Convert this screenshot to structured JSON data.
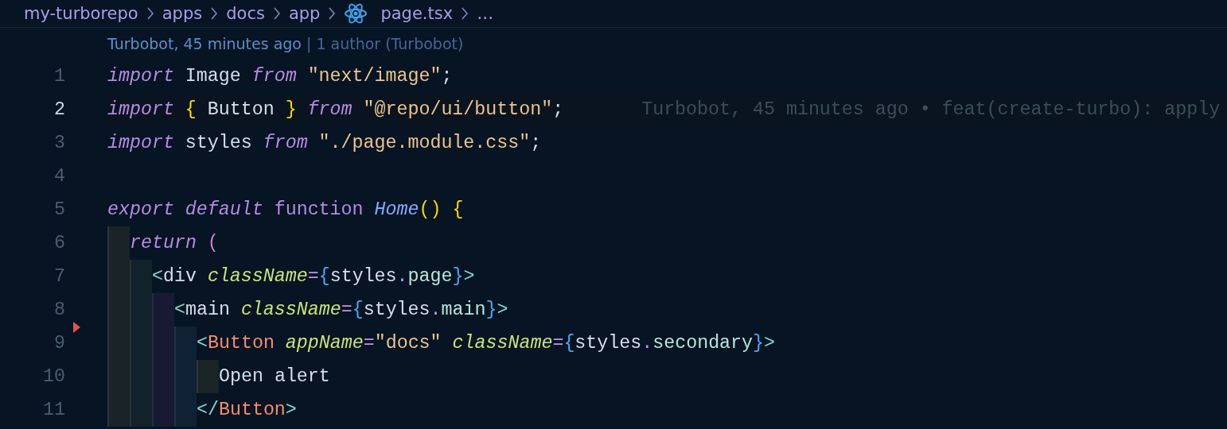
{
  "breadcrumb": [
    {
      "label": "my-turborepo",
      "kind": "folder"
    },
    {
      "label": "apps",
      "kind": "folder"
    },
    {
      "label": "docs",
      "kind": "folder"
    },
    {
      "label": "app",
      "kind": "folder"
    },
    {
      "label": "page.tsx",
      "kind": "react-file"
    },
    {
      "label": "…",
      "kind": "more"
    }
  ],
  "codelens": {
    "author_time": "Turbobot, 45 minutes ago",
    "authors": "| 1 author (Turbobot)"
  },
  "lines": [
    {
      "number": "1",
      "selected": false,
      "tokens": [
        {
          "t": "import",
          "kind": "keyword",
          "space_after": true
        },
        {
          "t": "Image",
          "kind": "plain",
          "space_after": true
        },
        {
          "t": "from",
          "kind": "keyword",
          "space_after": true
        },
        {
          "t": "\"next/image\"",
          "kind": "string"
        },
        {
          "t": ";",
          "kind": "plain"
        }
      ]
    },
    {
      "number": "2",
      "selected": true,
      "blame": "Turbobot, 45 minutes ago • feat(create-turbo): apply",
      "tokens": [
        {
          "t": "import",
          "kind": "keyword",
          "space_after": true
        },
        {
          "t": "{",
          "kind": "gold",
          "space_after": true
        },
        {
          "t": "Button",
          "kind": "plain",
          "space_after": true
        },
        {
          "t": "}",
          "kind": "gold",
          "space_after": true
        },
        {
          "t": "from",
          "kind": "keyword",
          "space_after": true
        },
        {
          "t": "\"@repo/ui/button\"",
          "kind": "string"
        },
        {
          "t": ";",
          "kind": "plain"
        }
      ]
    },
    {
      "number": "3",
      "selected": false,
      "tokens": [
        {
          "t": "import",
          "kind": "keyword",
          "space_after": true
        },
        {
          "t": "styles",
          "kind": "plain",
          "space_after": true
        },
        {
          "t": "from",
          "kind": "keyword",
          "space_after": true
        },
        {
          "t": "\"./page.module.css\"",
          "kind": "string"
        },
        {
          "t": ";",
          "kind": "plain"
        }
      ]
    },
    {
      "number": "4",
      "selected": false
    },
    {
      "number": "5",
      "selected": false,
      "tokens": [
        {
          "t": "export",
          "kind": "keyword",
          "space_after": true
        },
        {
          "t": "default",
          "kind": "keyword",
          "space_after": true
        },
        {
          "t": "function",
          "kind": "storage",
          "space_after": true
        },
        {
          "t": "Home",
          "kind": "funcname"
        },
        {
          "t": "()",
          "kind": "gold",
          "space_after": true
        },
        {
          "t": "{",
          "kind": "gold"
        }
      ]
    },
    {
      "number": "6",
      "selected": false,
      "indent_guides": [
        {
          "color": "#1a2428"
        }
      ],
      "tokens": [
        {
          "t": "return",
          "kind": "keyword",
          "space_after": true
        },
        {
          "t": "(",
          "kind": "pink"
        }
      ]
    },
    {
      "number": "7",
      "selected": false,
      "indent_guides": [
        {
          "color": "#1a2428"
        },
        {
          "color": "#11222a"
        }
      ],
      "tokens": [
        {
          "t": "<",
          "kind": "tagpunct"
        },
        {
          "t": "div",
          "kind": "plain",
          "space_after": true
        },
        {
          "t": "className",
          "kind": "attr"
        },
        {
          "t": "=",
          "kind": "operator"
        },
        {
          "t": "{",
          "kind": "blue"
        },
        {
          "t": "styles",
          "kind": "plain"
        },
        {
          "t": ".",
          "kind": "operator"
        },
        {
          "t": "page",
          "kind": "property"
        },
        {
          "t": "}",
          "kind": "blue"
        },
        {
          "t": ">",
          "kind": "tagpunct"
        }
      ]
    },
    {
      "number": "8",
      "selected": false,
      "indent_guides": [
        {
          "color": "#1a2428"
        },
        {
          "color": "#11222a"
        },
        {
          "color": "#181a33"
        }
      ],
      "tokens": [
        {
          "t": "<",
          "kind": "tagpunct"
        },
        {
          "t": "main",
          "kind": "plain",
          "space_after": true
        },
        {
          "t": "className",
          "kind": "attr"
        },
        {
          "t": "=",
          "kind": "operator"
        },
        {
          "t": "{",
          "kind": "blue"
        },
        {
          "t": "styles",
          "kind": "plain"
        },
        {
          "t": ".",
          "kind": "operator"
        },
        {
          "t": "main",
          "kind": "property"
        },
        {
          "t": "}",
          "kind": "blue"
        },
        {
          "t": ">",
          "kind": "tagpunct"
        }
      ]
    },
    {
      "number": "9",
      "selected": false,
      "error": true,
      "indent_guides": [
        {
          "color": "#1a2428"
        },
        {
          "color": "#11222a"
        },
        {
          "color": "#181a33"
        },
        {
          "color": "#0f2233"
        }
      ],
      "tokens": [
        {
          "t": "<",
          "kind": "tagpunct"
        },
        {
          "t": "Button",
          "kind": "component",
          "space_after": true
        },
        {
          "t": "appName",
          "kind": "attr"
        },
        {
          "t": "=",
          "kind": "operator"
        },
        {
          "t": "\"docs\"",
          "kind": "string",
          "space_after": true
        },
        {
          "t": "className",
          "kind": "attr"
        },
        {
          "t": "=",
          "kind": "operator"
        },
        {
          "t": "{",
          "kind": "blue"
        },
        {
          "t": "styles",
          "kind": "plain"
        },
        {
          "t": ".",
          "kind": "operator"
        },
        {
          "t": "secondary",
          "kind": "property"
        },
        {
          "t": "}",
          "kind": "blue"
        },
        {
          "t": ">",
          "kind": "tagpunct"
        }
      ]
    },
    {
      "number": "10",
      "selected": false,
      "indent_guides": [
        {
          "color": "#1a2428"
        },
        {
          "color": "#11222a"
        },
        {
          "color": "#181a33"
        },
        {
          "color": "#0f2233"
        },
        {
          "color": "#1b2426"
        }
      ],
      "tokens": [
        {
          "t": "Open alert",
          "kind": "plain"
        }
      ]
    },
    {
      "number": "11",
      "selected": false,
      "indent_guides": [
        {
          "color": "#1a2428"
        },
        {
          "color": "#11222a"
        },
        {
          "color": "#181a33"
        },
        {
          "color": "#0f2233"
        }
      ],
      "tokens": [
        {
          "t": "</",
          "kind": "tagpunct"
        },
        {
          "t": "Button",
          "kind": "component"
        },
        {
          "t": ">",
          "kind": "tagpunct"
        }
      ]
    }
  ]
}
